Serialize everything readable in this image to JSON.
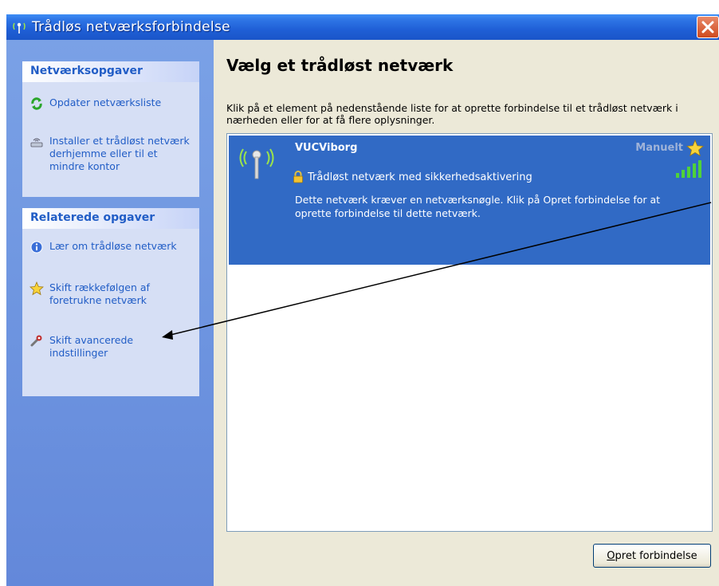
{
  "window": {
    "title": "Trådløs netværksforbindelse",
    "close_label": "×"
  },
  "sidebar": {
    "network_tasks": {
      "header": "Netværksopgaver",
      "items": [
        {
          "label": "Opdater netværksliste",
          "icon": "refresh-icon"
        },
        {
          "label": "Installer et trådløst netværk derhjemme eller til et mindre kontor",
          "icon": "wireless-setup-icon"
        }
      ]
    },
    "related_tasks": {
      "header": "Relaterede opgaver",
      "items": [
        {
          "label": "Lær om trådløse netværk",
          "icon": "info-icon"
        },
        {
          "label": "Skift rækkefølgen af foretrukne netværk",
          "icon": "star-icon"
        },
        {
          "label": "Skift avancerede indstillinger",
          "icon": "settings-icon"
        }
      ]
    }
  },
  "main": {
    "title": "Vælg et trådløst netværk",
    "description": "Klik på et element på nedenstående liste for at oprette forbindelse til et trådløst netværk i nærheden eller for at få flere oplysninger.",
    "networks": [
      {
        "name": "VUCViborg",
        "mode": "Manuelt",
        "security": "Trådløst netværk med sikkerhedsaktivering",
        "message": "Dette netværk kræver en netværksnøgle. Klik på Opret forbindelse for at oprette forbindelse til dette netværk.",
        "signal_bars": 5
      }
    ],
    "connect_button": {
      "mnemonic": "O",
      "rest": "pret forbindelse"
    }
  },
  "colors": {
    "title_bar": "#1f5fd6",
    "side_panel": "#6e95e0",
    "selected_item": "#316ac5",
    "task_text": "#215dc6",
    "main_bg": "#ece9d8"
  }
}
